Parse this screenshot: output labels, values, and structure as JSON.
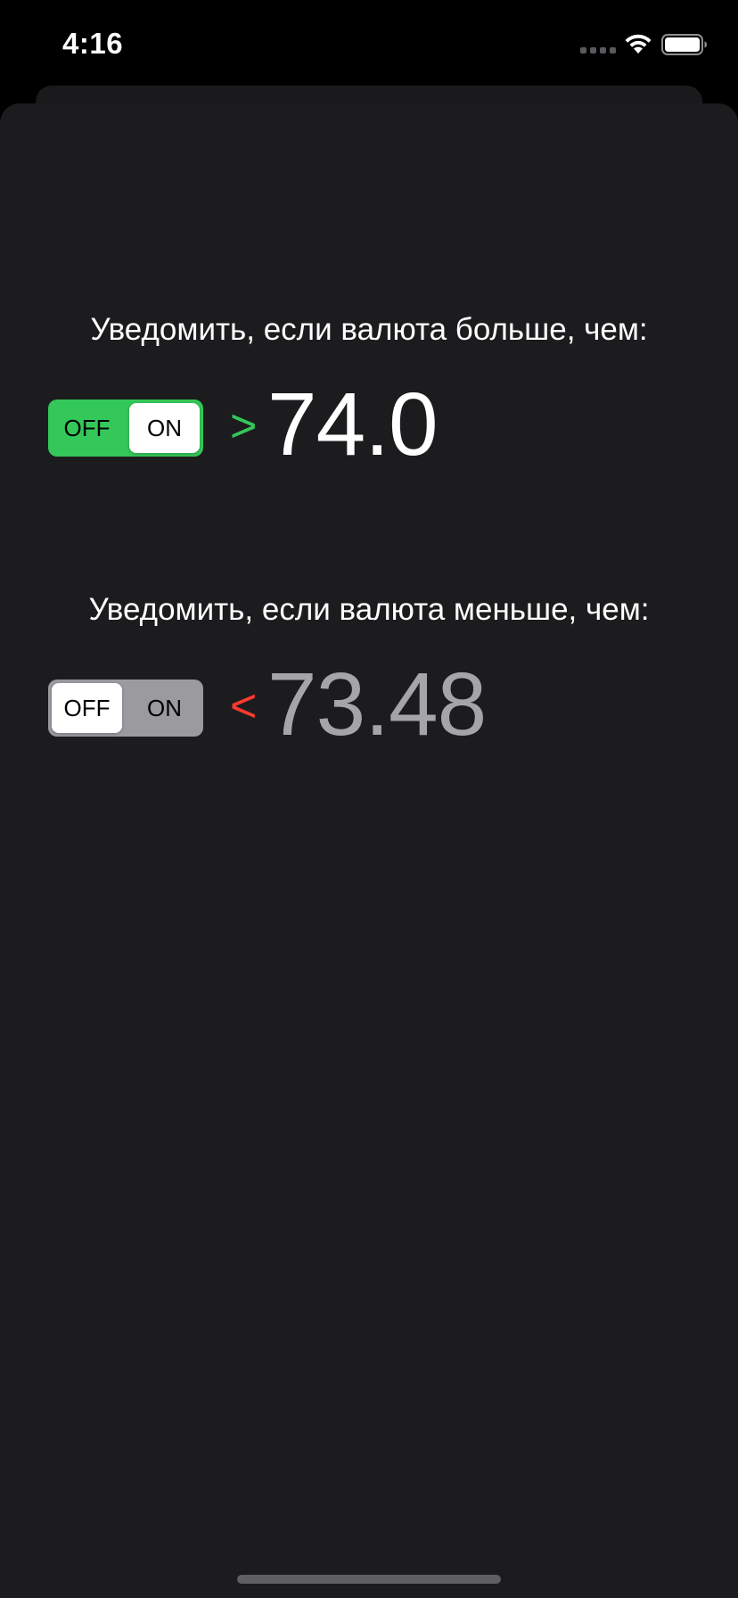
{
  "status_bar": {
    "time": "4:16"
  },
  "upper_alert": {
    "label": "Уведомить, если валюта больше, чем:",
    "toggle": {
      "off_label": "OFF",
      "on_label": "ON",
      "selected": "ON",
      "accent_color": "#34c759"
    },
    "sign": ">",
    "sign_color": "#34c759",
    "value": "74.0",
    "value_color": "#ffffff"
  },
  "lower_alert": {
    "label": "Уведомить, если валюта меньше, чем:",
    "toggle": {
      "off_label": "OFF",
      "on_label": "ON",
      "selected": "OFF",
      "accent_color": "#9a9a9f"
    },
    "sign": "<",
    "sign_color": "#ff3b30",
    "value": "73.48",
    "value_color": "#a5a5a9"
  },
  "icons": {
    "cellular": "cellular-signal-icon",
    "wifi": "wifi-icon",
    "battery": "battery-icon"
  }
}
